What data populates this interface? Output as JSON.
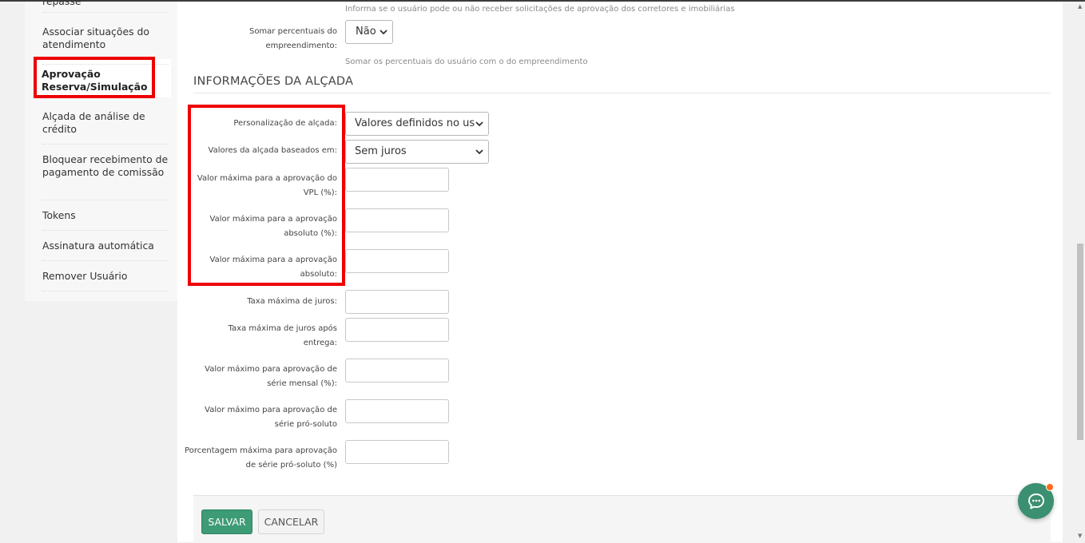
{
  "sidebar": {
    "items": [
      {
        "label": "repasse"
      },
      {
        "label": "Associar situações do atendimento"
      },
      {
        "label": "Aprovação Reserva/Simulação",
        "active": true
      },
      {
        "label": "Alçada de análise de crédito"
      },
      {
        "label": "Bloquear recebimento de pagamento de comissão"
      },
      {
        "label": "Tokens"
      },
      {
        "label": "Assinatura automática"
      },
      {
        "label": "Remover Usuário"
      }
    ]
  },
  "form_top": {
    "help_approval": "Informa se o usuário pode ou não receber solicitações de aprovação dos corretores e imobiliárias",
    "sum_label": "Somar percentuais do empreendimento:",
    "sum_value": "Não",
    "sum_help": "Somar os percentuais do usuário com o do empreendimento"
  },
  "section": {
    "title": "INFORMAÇÕES DA ALÇADA"
  },
  "fields": {
    "personalizacao_label": "Personalização de alçada:",
    "personalizacao_value": "Valores definidos no us",
    "baseados_label": "Valores da alçada baseados em:",
    "baseados_value": "Sem juros",
    "vpl_label": "Valor máxima para a aprovação do VPL (%):",
    "absoluto_pct_label": "Valor máxima para a aprovação absoluto (%):",
    "absoluto_label": "Valor máxima para a aprovação absoluto:",
    "taxa_label": "Taxa máxima de juros:",
    "taxa_entrega_label": "Taxa máxima de juros após entrega:",
    "serie_mensal_label": "Valor máximo para aprovação de série mensal (%):",
    "serie_pro_label": "Valor máximo para aprovação de série pró-soluto",
    "porcentagem_label": "Porcentagem máxima para aprovação de série pró-soluto (%)"
  },
  "buttons": {
    "save": "SALVAR",
    "cancel": "CANCELAR"
  },
  "colors": {
    "highlight": "#ee0000",
    "primary": "#3d9b76",
    "chat": "#3a9070",
    "notification": "#ff6a1a"
  }
}
